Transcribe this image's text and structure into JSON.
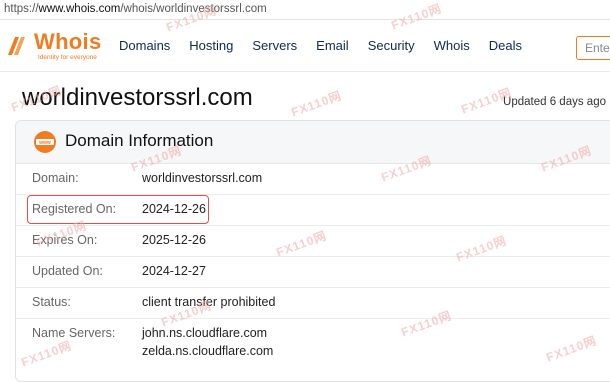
{
  "browser": {
    "url_prefix": "https://",
    "url_host": "www.whois.com",
    "url_path": "/whois/worldinvestorssrl.com"
  },
  "header": {
    "logo_text": "Whois",
    "logo_tagline": "Identity for everyone",
    "nav": [
      "Domains",
      "Hosting",
      "Servers",
      "Email",
      "Security",
      "Whois",
      "Deals"
    ],
    "search_placeholder": "Enter"
  },
  "page": {
    "domain": "worldinvestorssrl.com",
    "updated": "Updated 6 days ago"
  },
  "card": {
    "title": "Domain Information",
    "rows": [
      {
        "label": "Domain:",
        "values": [
          "worldinvestorssrl.com"
        ]
      },
      {
        "label": "Registered On:",
        "values": [
          "2024-12-26"
        ]
      },
      {
        "label": "Expires On:",
        "values": [
          "2025-12-26"
        ]
      },
      {
        "label": "Updated On:",
        "values": [
          "2024-12-27"
        ]
      },
      {
        "label": "Status:",
        "values": [
          "client transfer prohibited"
        ]
      },
      {
        "label": "Name Servers:",
        "values": [
          "john.ns.cloudflare.com",
          "zelda.ns.cloudflare.com"
        ]
      }
    ]
  },
  "watermark": "FX110网",
  "colors": {
    "brand": "#f07c22",
    "highlight": "#d9534f",
    "nav": "#0d2b4e"
  }
}
